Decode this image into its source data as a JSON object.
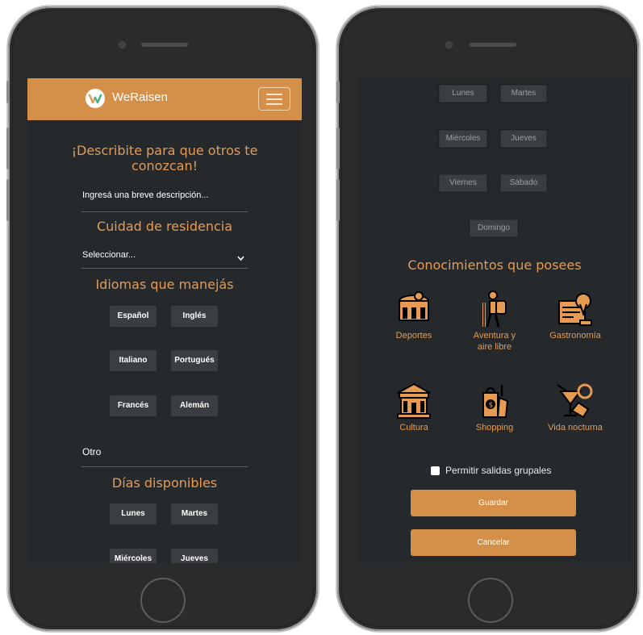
{
  "left_screen": {
    "brand": {
      "name": "WeRaisen"
    },
    "describe_title": "¡Describite para que otros te conozcan!",
    "description_placeholder": "Ingresá una breve descripción...",
    "residence_title": "Cuidad de residencia",
    "residence_select_value": "Seleccionar...",
    "languages_title": "Idiomas que manejás",
    "languages": [
      "Español",
      "Inglés",
      "Italiano",
      "Portugués",
      "Francés",
      "Alemán"
    ],
    "other_language_label": "Otro",
    "days_title": "Días disponibles",
    "days_visible": [
      "Lunes",
      "Martes",
      "Miércoles",
      "Jueves"
    ]
  },
  "right_screen": {
    "days": [
      "Lunes",
      "Martes",
      "Miércoles",
      "Jueves",
      "Viernes",
      "Sábado",
      "Domingo"
    ],
    "knowledge_title": "Conocimientos que posees",
    "knowledge_items": [
      {
        "label": "Deportes",
        "icon": "stadium-icon"
      },
      {
        "label": "Aventura y aire libre",
        "icon": "hiker-icon"
      },
      {
        "label": "Gastronomía",
        "icon": "food-map-icon"
      },
      {
        "label": "Cultura",
        "icon": "museum-icon"
      },
      {
        "label": "Shopping",
        "icon": "shopping-icon"
      },
      {
        "label": "Vida nocturna",
        "icon": "cocktail-icon"
      }
    ],
    "group_outings_label": "Permitir salidas grupales",
    "save_label": "Guardar",
    "cancel_label": "Cancelar"
  },
  "colors": {
    "accent": "#d48f49",
    "background": "#25292c",
    "chip": "#3a3e42"
  }
}
